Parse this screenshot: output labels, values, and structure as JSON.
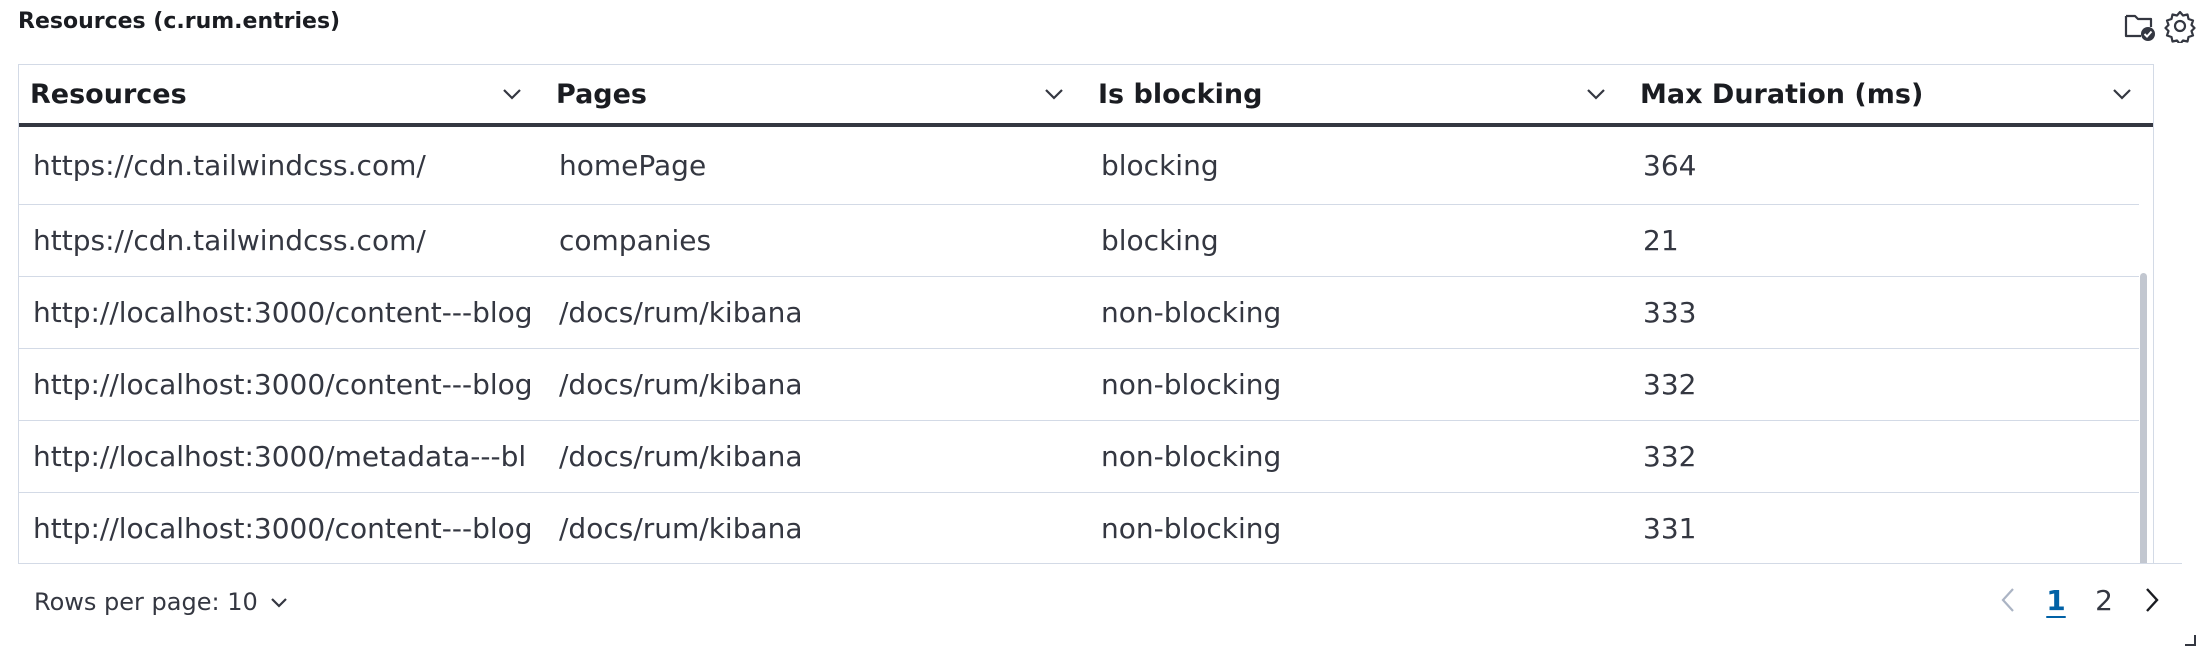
{
  "panel": {
    "title": "Resources (c.rum.entries)"
  },
  "table": {
    "columns": [
      {
        "label": "Resources"
      },
      {
        "label": "Pages"
      },
      {
        "label": "Is blocking"
      },
      {
        "label": "Max Duration (ms)"
      }
    ],
    "rows": [
      [
        "https://cdn.tailwindcss.com/",
        "homePage",
        "blocking",
        "364"
      ],
      [
        "https://cdn.tailwindcss.com/",
        "companies",
        "blocking",
        "21"
      ],
      [
        "http://localhost:3000/content---blog",
        "/docs/rum/kibana",
        "non-blocking",
        "333"
      ],
      [
        "http://localhost:3000/content---blog",
        "/docs/rum/kibana",
        "non-blocking",
        "332"
      ],
      [
        "http://localhost:3000/metadata---bl",
        "/docs/rum/kibana",
        "non-blocking",
        "332"
      ],
      [
        "http://localhost:3000/content---blog",
        "/docs/rum/kibana",
        "non-blocking",
        "331"
      ]
    ]
  },
  "footer": {
    "rows_per_page_label": "Rows per page: 10",
    "pages": [
      "1",
      "2"
    ],
    "current_page": "1"
  },
  "icons": {
    "folder_check": "folder-check-icon",
    "settings": "gear-icon",
    "column_menu": "chevron-down-icon",
    "prev": "chevron-left-icon",
    "next": "chevron-right-icon"
  },
  "colors": {
    "accent": "#0061a6",
    "header_border": "#343741",
    "row_border": "#d3dae6",
    "text": "#343741"
  }
}
